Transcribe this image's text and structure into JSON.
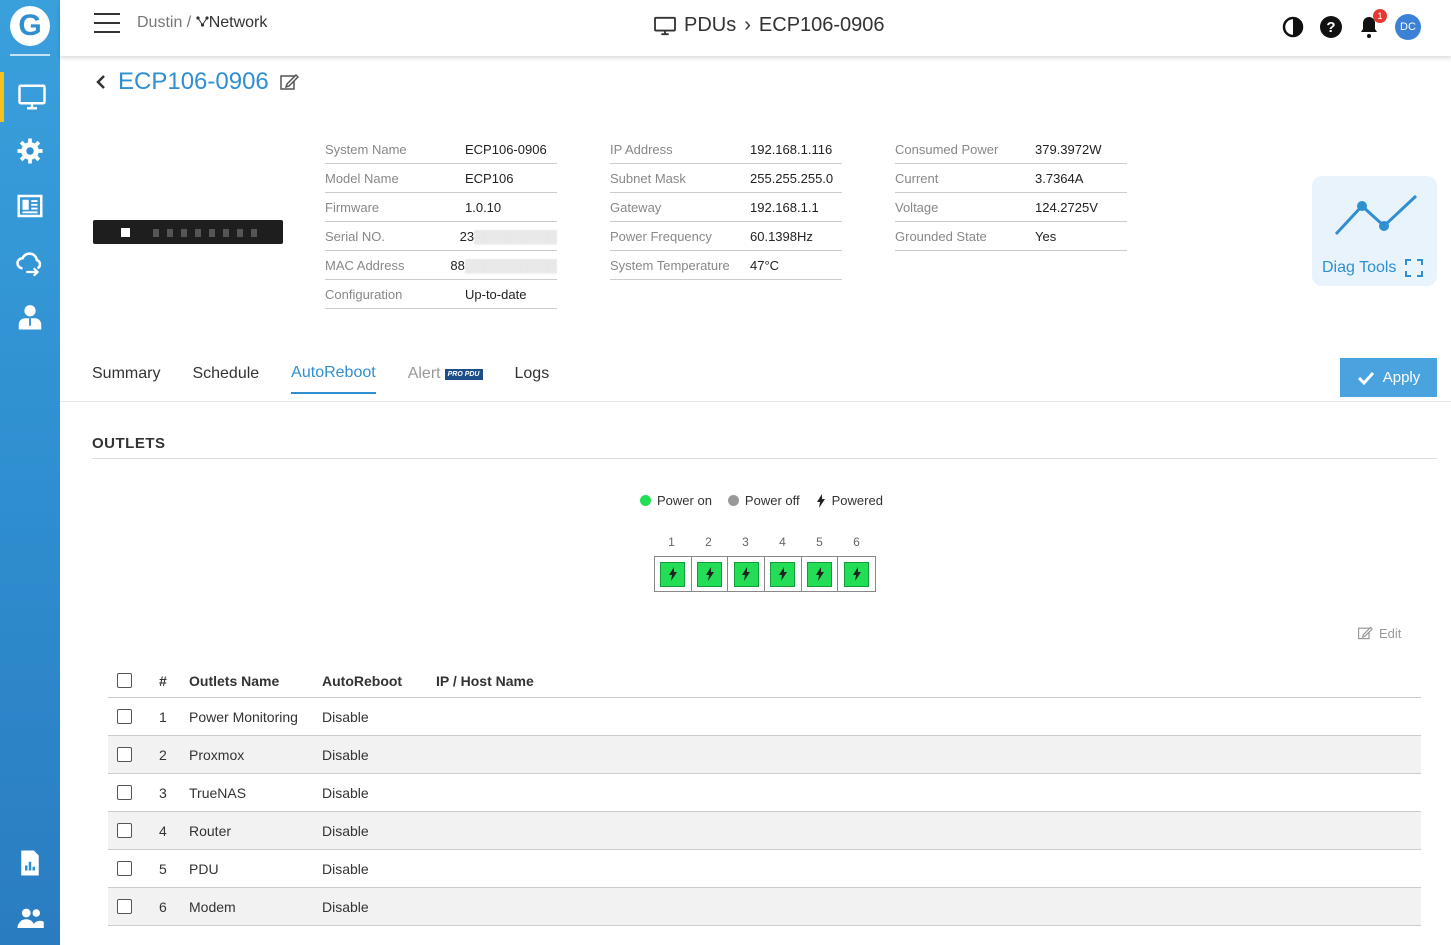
{
  "breadcrumb": {
    "org": "Dustin /",
    "network": "Network"
  },
  "header": {
    "section": "PDUs",
    "separator": "›",
    "device": "ECP106-0906",
    "notifications": "1",
    "avatar": "DC"
  },
  "device": {
    "title": "ECP106-0906"
  },
  "info": {
    "col1": [
      {
        "label": "System Name",
        "value": "ECP106-0906"
      },
      {
        "label": "Model Name",
        "value": "ECP106"
      },
      {
        "label": "Firmware",
        "value": "1.0.10"
      },
      {
        "label": "Serial NO.",
        "value": "23"
      },
      {
        "label": "MAC Address",
        "value": "88"
      },
      {
        "label": "Configuration",
        "value": "Up-to-date"
      }
    ],
    "col2": [
      {
        "label": "IP Address",
        "value": "192.168.1.116"
      },
      {
        "label": "Subnet Mask",
        "value": "255.255.255.0"
      },
      {
        "label": "Gateway",
        "value": "192.168.1.1"
      },
      {
        "label": "Power Frequency",
        "value": "60.1398Hz"
      },
      {
        "label": "System Temperature",
        "value": "47°C"
      }
    ],
    "col3": [
      {
        "label": "Consumed Power",
        "value": "379.3972W"
      },
      {
        "label": "Current",
        "value": "3.7364A"
      },
      {
        "label": "Voltage",
        "value": "124.2725V"
      },
      {
        "label": "Grounded State",
        "value": "Yes"
      }
    ]
  },
  "diag": {
    "label": "Diag Tools"
  },
  "tabs": [
    {
      "label": "Summary"
    },
    {
      "label": "Schedule"
    },
    {
      "label": "AutoReboot"
    },
    {
      "label": "Alert",
      "badge": "PRO PDU"
    },
    {
      "label": "Logs"
    }
  ],
  "apply_label": "Apply",
  "outlets_title": "OUTLETS",
  "legend": {
    "on": "Power on",
    "off": "Power off",
    "powered": "Powered"
  },
  "colors": {
    "on": "#22dd55",
    "off": "#999999",
    "accent": "#2f8fd0"
  },
  "outlet_numbers": [
    "1",
    "2",
    "3",
    "4",
    "5",
    "6"
  ],
  "edit_label": "Edit",
  "table": {
    "headers": {
      "num": "#",
      "name": "Outlets Name",
      "autoreboot": "AutoReboot",
      "ip": "IP / Host Name"
    },
    "rows": [
      {
        "num": "1",
        "name": "Power Monitoring",
        "autoreboot": "Disable",
        "ip": ""
      },
      {
        "num": "2",
        "name": "Proxmox",
        "autoreboot": "Disable",
        "ip": ""
      },
      {
        "num": "3",
        "name": "TrueNAS",
        "autoreboot": "Disable",
        "ip": ""
      },
      {
        "num": "4",
        "name": "Router",
        "autoreboot": "Disable",
        "ip": ""
      },
      {
        "num": "5",
        "name": "PDU",
        "autoreboot": "Disable",
        "ip": ""
      },
      {
        "num": "6",
        "name": "Modem",
        "autoreboot": "Disable",
        "ip": ""
      }
    ]
  }
}
